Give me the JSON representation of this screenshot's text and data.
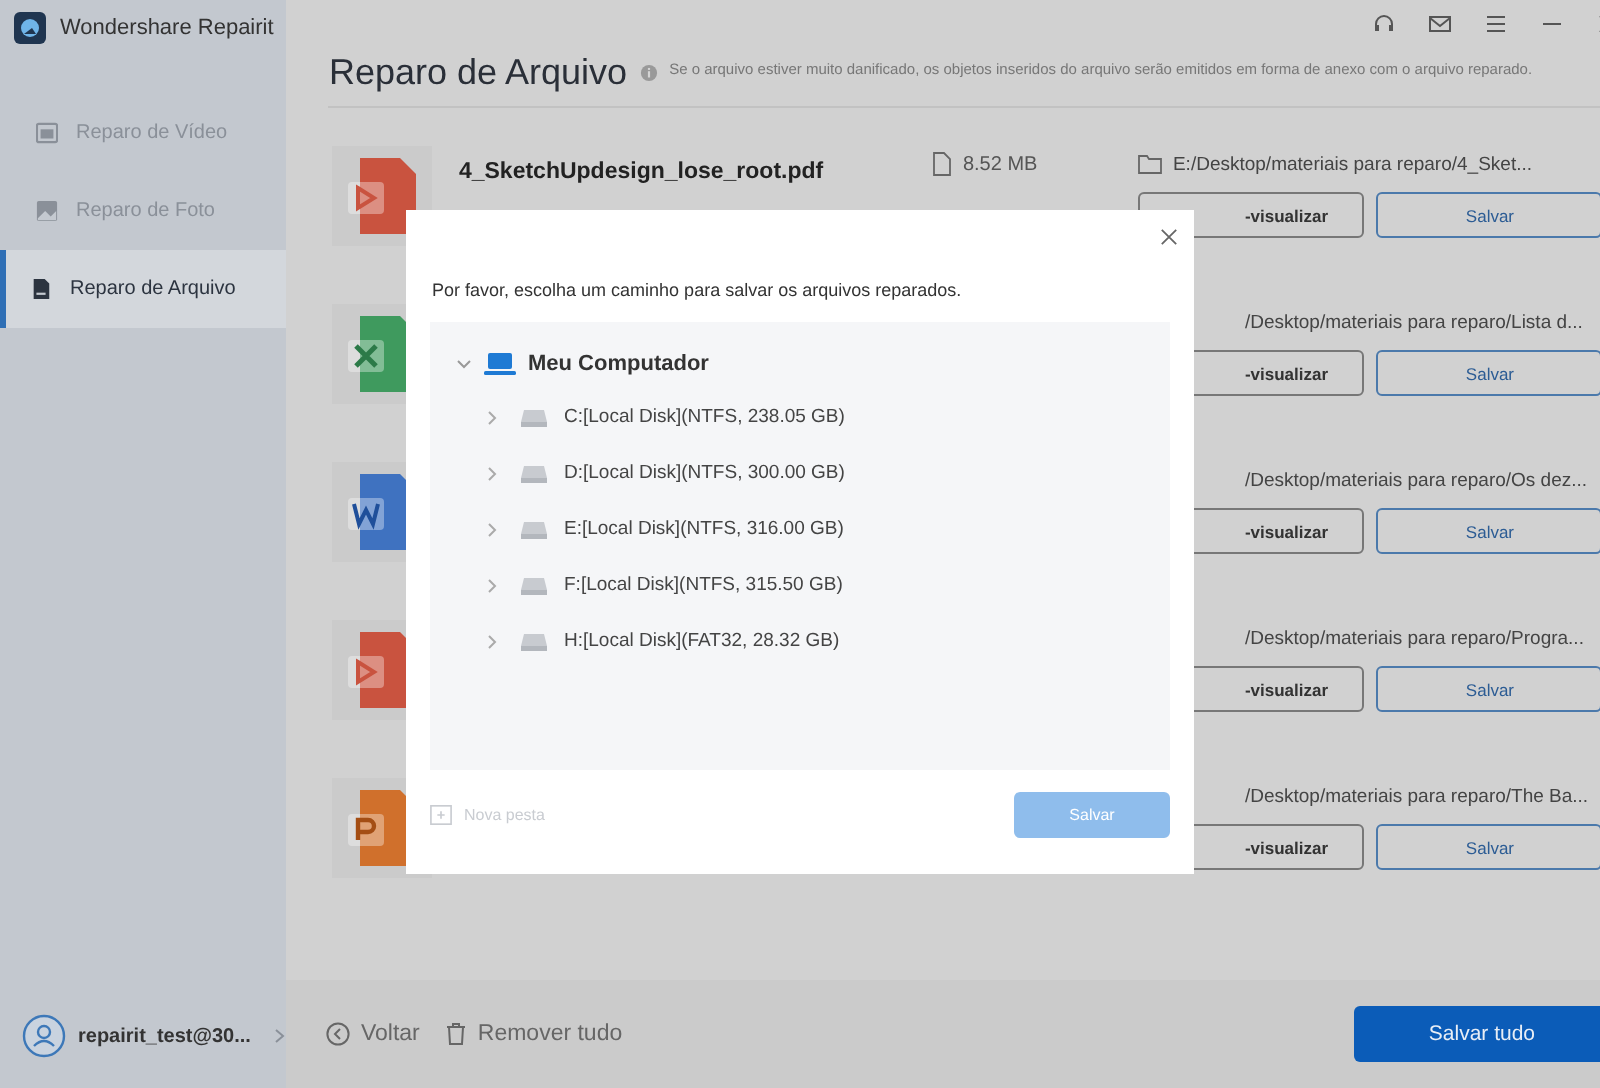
{
  "app": {
    "title": "Wondershare Repairit"
  },
  "sidebar": {
    "items": [
      {
        "label": "Reparo de Vídeo",
        "kind": "video",
        "selected": false
      },
      {
        "label": "Reparo de Foto",
        "kind": "photo",
        "selected": false
      },
      {
        "label": "Reparo de Arquivo",
        "kind": "file",
        "selected": true
      }
    ],
    "user": "repairit_test@30..."
  },
  "header": {
    "title": "Reparo de Arquivo",
    "note": "Se o arquivo estiver muito danificado, os objetos inseridos do arquivo serão emitidos em forma de anexo com o arquivo reparado."
  },
  "files": [
    {
      "kind": "pdf",
      "name": "4_SketchUpdesign_lose_root.pdf",
      "size": "8.52  MB",
      "path": "E:/Desktop/materiais para reparo/4_Sket...",
      "preview_button": "-visualizar",
      "save_button": "Salvar"
    },
    {
      "kind": "excel",
      "path": "/Desktop/materiais para reparo/Lista d...",
      "preview_button": "-visualizar",
      "save_button": "Salvar"
    },
    {
      "kind": "word",
      "path": "/Desktop/materiais para reparo/Os dez...",
      "preview_button": "-visualizar",
      "save_button": "Salvar"
    },
    {
      "kind": "pdf",
      "path": "/Desktop/materiais para reparo/Progra...",
      "preview_button": "-visualizar",
      "save_button": "Salvar"
    },
    {
      "kind": "ppt",
      "path": "/Desktop/materiais para reparo/The Ba...",
      "preview_button": "-visualizar",
      "save_button": "Salvar"
    }
  ],
  "footer": {
    "back": "Voltar",
    "remove_all": "Remover tudo",
    "save_all": "Salvar tudo"
  },
  "dialog": {
    "message": "Por favor, escolha um caminho para salvar os arquivos reparados.",
    "tree": [
      {
        "label": "Meu Computador",
        "expanded": true,
        "children": [
          {
            "label": "C:[Local Disk](NTFS, 238.05  GB)",
            "expanded": false
          },
          {
            "label": "D:[Local Disk](NTFS, 300.00  GB)",
            "expanded": false
          },
          {
            "label": "E:[Local Disk](NTFS, 316.00  GB)",
            "expanded": false
          },
          {
            "label": "F:[Local Disk](NTFS, 315.50  GB)",
            "expanded": false
          },
          {
            "label": "H:[Local Disk](FAT32, 28.32  GB)",
            "expanded": false
          }
        ]
      }
    ],
    "new_folder": {
      "label": "Nova pesta",
      "disabled": true
    },
    "save_button": {
      "label": "Salvar",
      "disabled": true
    }
  }
}
